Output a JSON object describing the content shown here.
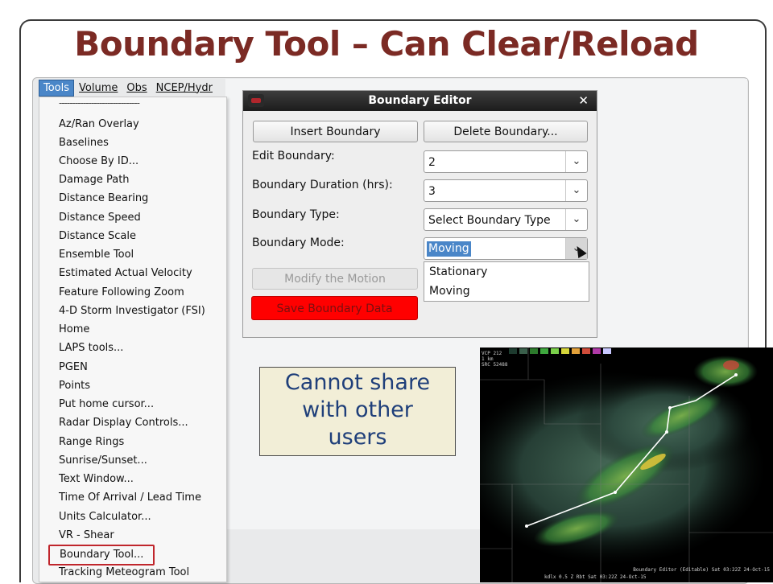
{
  "slide": {
    "title": "Boundary Tool – Can Clear/Reload",
    "title_color": "#7b2a24"
  },
  "menubar": {
    "items": [
      {
        "label": "Tools",
        "active": true
      },
      {
        "label": "Volume",
        "active": false
      },
      {
        "label": "Obs",
        "active": false
      },
      {
        "label": "NCEP/Hydr",
        "active": false
      }
    ]
  },
  "tools_menu": {
    "separator": "------------------------------",
    "items": [
      "Az/Ran Overlay",
      "Baselines",
      "Choose By ID...",
      "Damage Path",
      "Distance Bearing",
      "Distance Speed",
      "Distance Scale",
      "Ensemble Tool",
      "Estimated Actual Velocity",
      "Feature Following Zoom",
      "4-D Storm Investigator (FSI)",
      "Home",
      "LAPS tools...",
      "PGEN",
      "Points",
      "Put home cursor...",
      "Radar Display Controls...",
      "Range Rings",
      "Sunrise/Sunset...",
      "Text Window...",
      "Time Of Arrival / Lead Time",
      "Units Calculator...",
      "VR - Shear",
      "Boundary Tool...",
      "Tracking Meteogram Tool"
    ],
    "highlighted_item": "Boundary Tool...",
    "highlight_color": "#c0262c"
  },
  "dialog": {
    "title": "Boundary Editor",
    "close_icon": "close-icon",
    "insert_label": "Insert Boundary",
    "delete_label": "Delete Boundary...",
    "edit_label": "Edit Boundary:",
    "edit_value": "2",
    "duration_label": "Boundary Duration (hrs):",
    "duration_value": "3",
    "type_label": "Boundary Type:",
    "type_value": "Select Boundary Type",
    "mode_label": "Boundary Mode:",
    "mode_value": "Moving",
    "mode_options": [
      "Stationary",
      "Moving"
    ],
    "modify_label": "Modify the Motion",
    "save_label": "Save Boundary Data",
    "save_color": "#ff0000"
  },
  "callout": {
    "lines": [
      "Cannot share",
      "with other",
      "users"
    ],
    "text_color": "#1f3f7a",
    "background": "#f2eed7"
  },
  "radar": {
    "header_lines": [
      "VCP 212",
      "1 km",
      "SRC 52488"
    ],
    "footer_text": "kdlx 0.5 Z Rbt Sat 03:22Z 24-Oct-15",
    "footer_right": "Boundary Editor (Editable)   Sat 03:22Z 24-Oct-15",
    "colors": [
      "#1d3a2e",
      "#3a5f4b",
      "#2c7a2c",
      "#3fa83f",
      "#7ad04a",
      "#d6d63a",
      "#e3a13a",
      "#d04c3a",
      "#b03aa8",
      "#c8c8ff"
    ]
  }
}
